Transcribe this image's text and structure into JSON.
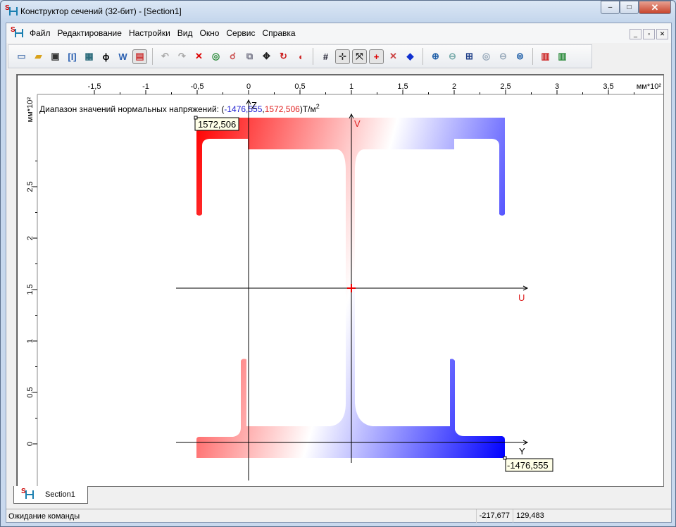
{
  "window": {
    "title": "Конструктор сечений (32-бит) - [Section1]",
    "minimize": "–",
    "maximize": "□",
    "close": "✕"
  },
  "menu": {
    "items": [
      "Файл",
      "Редактирование",
      "Настройки",
      "Вид",
      "Окно",
      "Сервис",
      "Справка"
    ],
    "mdi": [
      "_",
      "▫",
      "✕"
    ]
  },
  "toolbar": {
    "buttons": [
      {
        "icon": "new-file-icon",
        "glyph": "▭",
        "color": "#5a7fb5"
      },
      {
        "icon": "open-folder-icon",
        "glyph": "▰",
        "color": "#d9a21b"
      },
      {
        "icon": "save-icon",
        "glyph": "▣",
        "color": "#333"
      },
      {
        "icon": "profile-bracket-icon",
        "glyph": "[I]",
        "color": "#2a5fb0"
      },
      {
        "icon": "calculator-icon",
        "glyph": "▦",
        "color": "#2a6a7a"
      },
      {
        "icon": "phi-icon",
        "glyph": "ϕ",
        "color": "#000"
      },
      {
        "icon": "word-icon",
        "glyph": "W",
        "color": "#2a5fb0"
      },
      {
        "icon": "color-map-icon",
        "glyph": "▤",
        "color": "#c33",
        "active": true
      },
      {
        "sep": true
      },
      {
        "icon": "undo-icon",
        "glyph": "↶",
        "color": "#aaa"
      },
      {
        "icon": "redo-icon",
        "glyph": "↷",
        "color": "#aaa"
      },
      {
        "icon": "delete-icon",
        "glyph": "✕",
        "color": "#d00"
      },
      {
        "icon": "rotate-icon",
        "glyph": "◎",
        "color": "#2a8a3a"
      },
      {
        "icon": "move-point-icon",
        "glyph": "☌",
        "color": "#c55"
      },
      {
        "icon": "copy-icon",
        "glyph": "⧉",
        "color": "#778"
      },
      {
        "icon": "move-icon",
        "glyph": "✥",
        "color": "#222"
      },
      {
        "icon": "refresh-icon",
        "glyph": "↻",
        "color": "#c22"
      },
      {
        "icon": "mirror-icon",
        "glyph": "◖",
        "color": "#c22"
      },
      {
        "sep": true
      },
      {
        "icon": "grid-icon",
        "glyph": "#",
        "color": "#223"
      },
      {
        "icon": "axes-zy-icon",
        "glyph": "⊹",
        "color": "#222",
        "active": true
      },
      {
        "icon": "axes-uv-icon",
        "glyph": "⤧",
        "color": "#222",
        "active": true
      },
      {
        "icon": "center-cross-icon",
        "glyph": "+",
        "color": "#d00",
        "active": true
      },
      {
        "icon": "principal-axes-icon",
        "glyph": "✕",
        "color": "#c44"
      },
      {
        "icon": "point-icon",
        "glyph": "◆",
        "color": "#1030d0"
      },
      {
        "sep": true
      },
      {
        "icon": "zoom-in-icon",
        "glyph": "⊕",
        "color": "#1f5fa8"
      },
      {
        "icon": "zoom-out-icon",
        "glyph": "⊖",
        "color": "#7aa"
      },
      {
        "icon": "zoom-fit-icon",
        "glyph": "⊞",
        "color": "#1f3f88"
      },
      {
        "icon": "zoom-window-icon",
        "glyph": "◎",
        "color": "#9ab"
      },
      {
        "icon": "zoom-prev-icon",
        "glyph": "⊖",
        "color": "#9ab"
      },
      {
        "icon": "zoom-all-icon",
        "glyph": "⊜",
        "color": "#1f5fa8"
      },
      {
        "sep": true
      },
      {
        "icon": "section-report-icon",
        "glyph": "▥",
        "color": "#c22"
      },
      {
        "icon": "section-export-icon",
        "glyph": "▥",
        "color": "#2a8a3a"
      }
    ]
  },
  "canvas": {
    "top_ruler": {
      "ticks": [
        -1.5,
        -1,
        -0.5,
        0,
        0.5,
        1,
        1.5,
        2,
        2.5,
        3,
        3.5
      ],
      "labels": [
        "-1,5",
        "-1",
        "-0,5",
        "0",
        "0,5",
        "1",
        "1,5",
        "2",
        "2,5",
        "3",
        "3,5"
      ],
      "unit": "мм*10²"
    },
    "left_ruler": {
      "ticks": [
        0,
        0.5,
        1,
        1.5,
        2,
        2.5
      ],
      "labels": [
        "0",
        "0,5",
        "1",
        "1,5",
        "2",
        "2,5"
      ],
      "unit": "мм*10²"
    },
    "stress_range": {
      "prefix": "Диапазон значений нормальных напряжений: (",
      "min": "-1476,555",
      "comma": ",",
      "max": "1572,506",
      "suffix": ")Т/м",
      "sup": "2"
    },
    "max_label": "1572,506",
    "min_label": "-1476,555",
    "axes": {
      "z": "Z",
      "v": "V",
      "u": "U",
      "y": "Y"
    },
    "colors": {
      "max": "#ff0000",
      "zero": "#ffffff",
      "min": "#0000ff",
      "min_text": "#2020d0",
      "max_text": "#e02020"
    }
  },
  "tabs": [
    {
      "label": "Section1"
    }
  ],
  "status": {
    "message": "Ожидание команды",
    "x": "-217,677",
    "y": "129,483"
  }
}
